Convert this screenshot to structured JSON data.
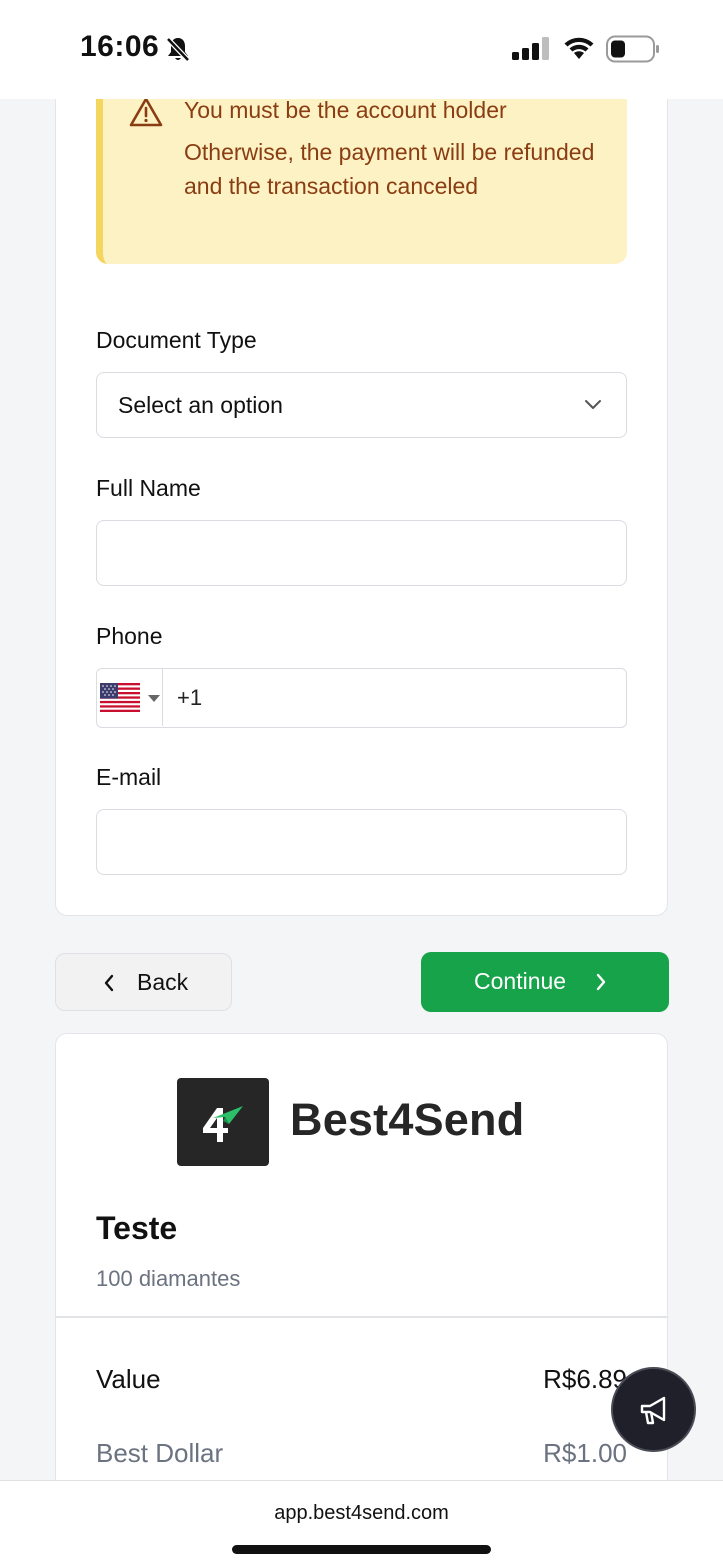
{
  "status_bar": {
    "time": "16:06",
    "icons": [
      "bell-slash-icon",
      "cellular-signal-icon",
      "wifi-icon",
      "battery-icon"
    ]
  },
  "warning": {
    "icon": "warning-triangle-icon",
    "title": "You must be the account holder",
    "body": "Otherwise, the payment will be refunded and the transaction canceled"
  },
  "form": {
    "document_type": {
      "label": "Document Type",
      "value": "Select an option"
    },
    "full_name": {
      "label": "Full Name",
      "value": ""
    },
    "phone": {
      "label": "Phone",
      "country_flag": "us-flag-icon",
      "value": "+1"
    },
    "email": {
      "label": "E-mail",
      "value": ""
    }
  },
  "actions": {
    "back_label": "Back",
    "continue_label": "Continue"
  },
  "colors": {
    "primary": "#17a34a",
    "warning_bg": "#fdf2c4",
    "warning_text": "#8a3d12"
  },
  "summary": {
    "brand": "Best4Send",
    "product_title": "Teste",
    "product_desc": "100 diamantes",
    "rows": [
      {
        "label": "Value",
        "value": "R$6.89"
      },
      {
        "label": "Best Dollar",
        "value": "R$1.00"
      }
    ]
  },
  "fab": {
    "icon": "megaphone-icon"
  },
  "browser": {
    "url": "app.best4send.com"
  }
}
